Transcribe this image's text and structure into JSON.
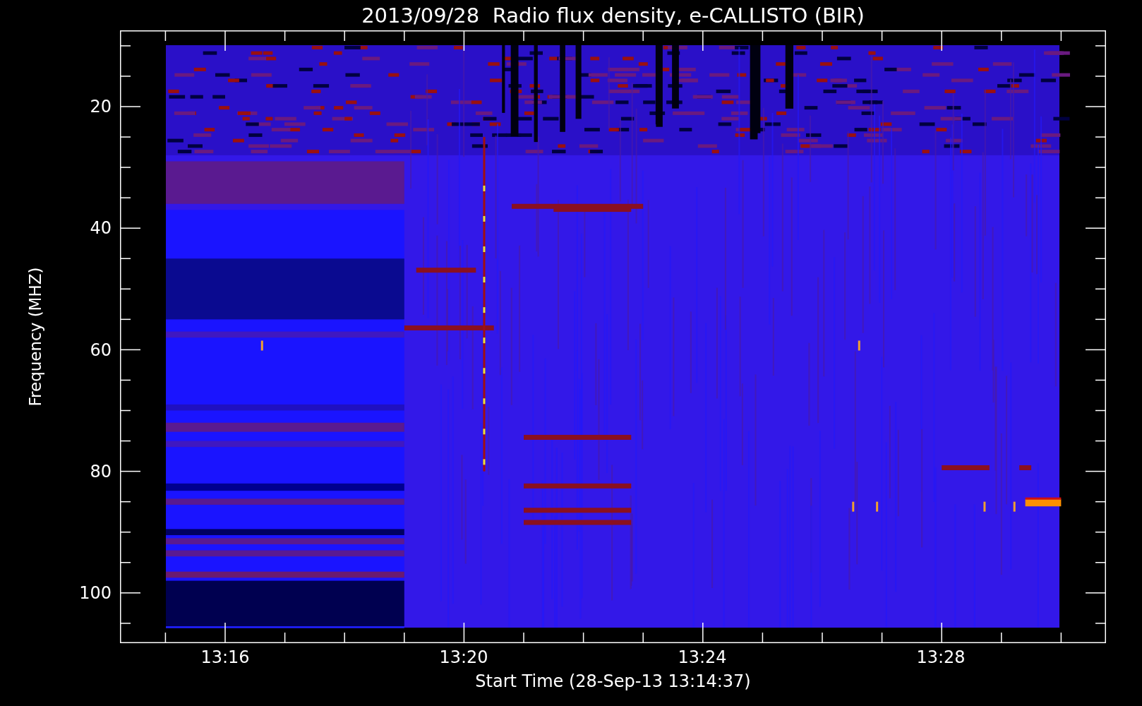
{
  "title": "2013/09/28  Radio flux density, e-CALLISTO (BIR)",
  "y_axis": {
    "label": "Frequency (MHZ)",
    "ticks": [
      "20",
      "40",
      "60",
      "80",
      "100"
    ]
  },
  "x_axis": {
    "label": "Start Time (28-Sep-13 13:14:37)",
    "ticks": [
      "13:16",
      "13:20",
      "13:24",
      "13:28"
    ]
  }
}
